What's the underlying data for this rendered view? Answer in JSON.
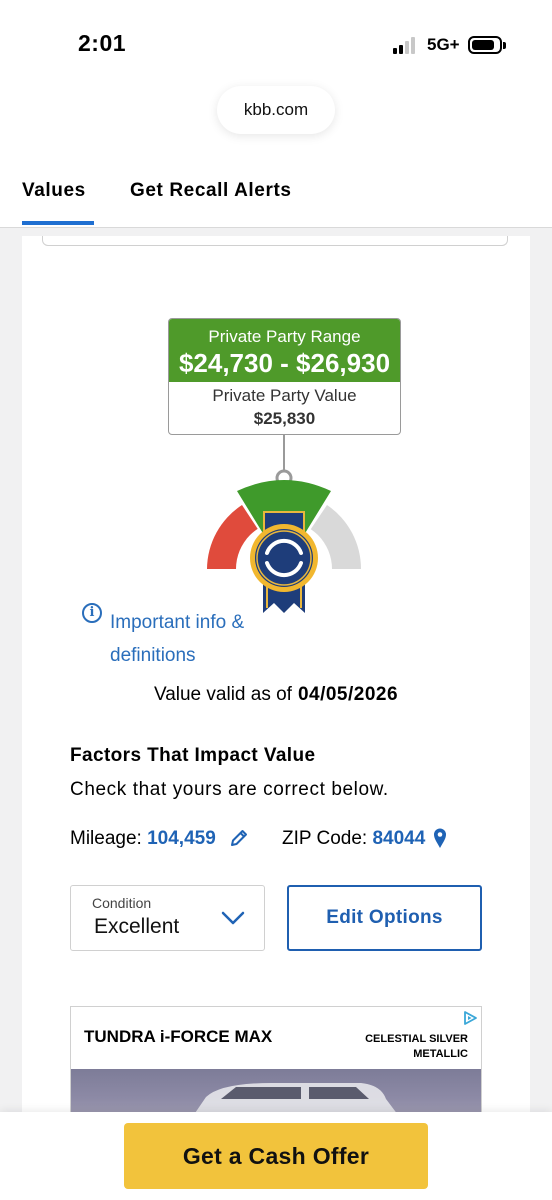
{
  "status_bar": {
    "time": "2:01",
    "network": "5G+"
  },
  "browser": {
    "url": "kbb.com"
  },
  "tabs": [
    {
      "label": "Values",
      "active": true
    },
    {
      "label": "Get Recall Alerts",
      "active": false
    }
  ],
  "valuation": {
    "range_label": "Private Party Range",
    "range_value": "$24,730 - $26,930",
    "value_label": "Private Party Value",
    "value": "$25,830"
  },
  "info_link": "Important info & definitions",
  "valid": {
    "label": "Value valid as of",
    "date": "04/05/2026"
  },
  "factors": {
    "title": "Factors That Impact Value",
    "subtitle": "Check that yours are correct below.",
    "mileage_label": "Mileage:",
    "mileage_value": "104,459",
    "zip_label": "ZIP Code:",
    "zip_value": "84044"
  },
  "condition": {
    "label": "Condition",
    "value": "Excellent"
  },
  "edit_options_label": "Edit Options",
  "ad": {
    "title": "TUNDRA i-FORCE MAX",
    "color_text": "CELESTIAL SILVER METALLIC"
  },
  "cta_label": "Get a Cash Offer",
  "colors": {
    "accent_blue": "#1f63b5",
    "range_green": "#4f9a2a",
    "gauge_red": "#e04b3c",
    "gauge_gray": "#d9d9d9",
    "cta_yellow": "#f2c33c"
  }
}
